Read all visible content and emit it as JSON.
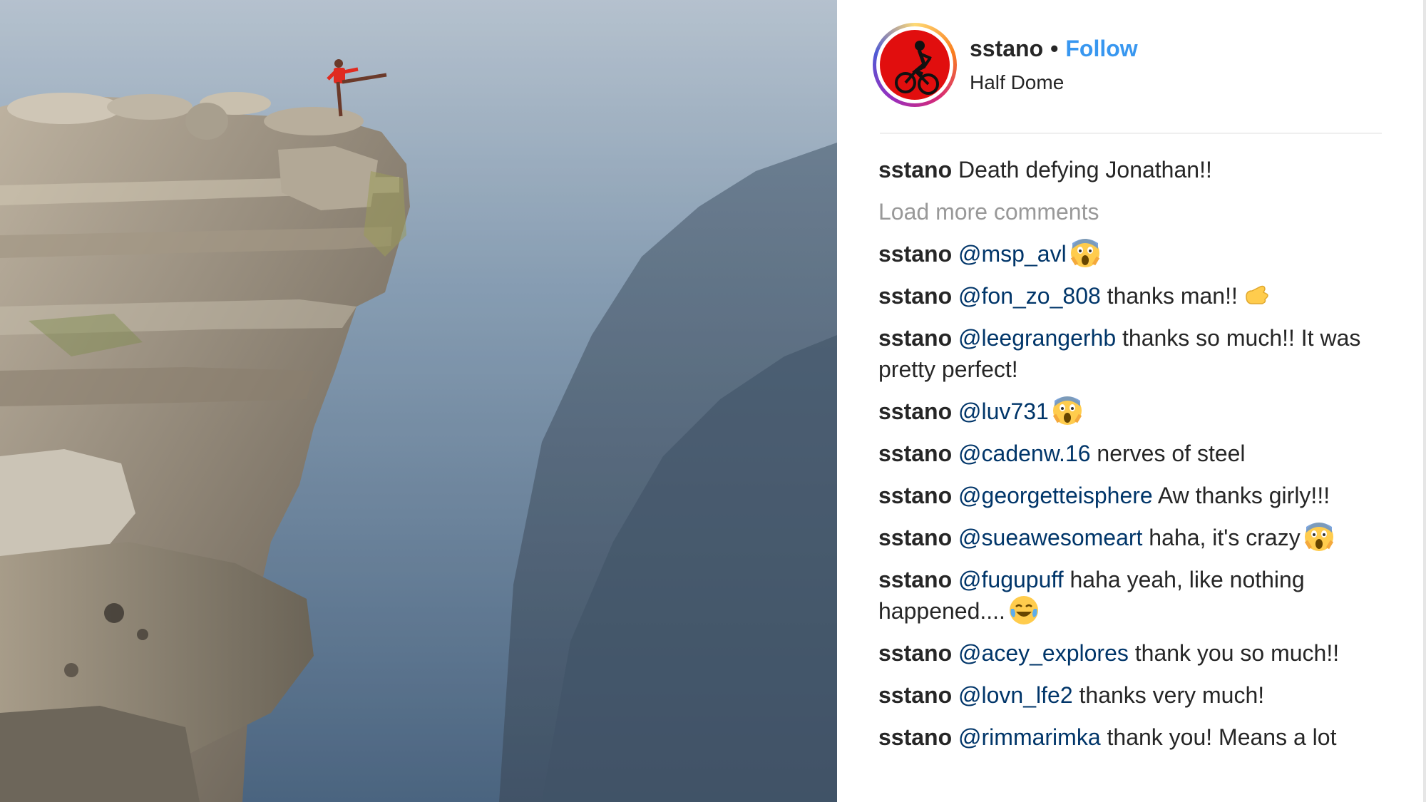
{
  "post": {
    "username": "sstano",
    "separator": "•",
    "follow_label": "Follow",
    "location": "Half Dome",
    "caption": {
      "user": "sstano",
      "text": "Death defying Jonathan!!"
    },
    "load_more_label": "Load more comments",
    "comments": [
      {
        "user": "sstano",
        "mention": "@msp_avl",
        "text": "",
        "emoji": "scream-emoji"
      },
      {
        "user": "sstano",
        "mention": "@fon_zo_808",
        "text": "thanks man!!",
        "emoji": "call-me-hand-emoji"
      },
      {
        "user": "sstano",
        "mention": "@leegrangerhb",
        "text": "thanks so much!! It was pretty perfect!",
        "emoji": ""
      },
      {
        "user": "sstano",
        "mention": "@luv731",
        "text": "",
        "emoji": "scream-emoji"
      },
      {
        "user": "sstano",
        "mention": "@cadenw.16",
        "text": "nerves of steel",
        "emoji": ""
      },
      {
        "user": "sstano",
        "mention": "@georgetteisphere",
        "text": "Aw thanks girly!!!",
        "emoji": ""
      },
      {
        "user": "sstano",
        "mention": "@sueawesomeart",
        "text": "haha, it's crazy",
        "emoji": "scream-emoji"
      },
      {
        "user": "sstano",
        "mention": "@fugupuff",
        "text": "haha yeah, like nothing happened....",
        "emoji": "tears-of-joy-emoji"
      },
      {
        "user": "sstano",
        "mention": "@acey_explores",
        "text": "thank you so much!!",
        "emoji": ""
      },
      {
        "user": "sstano",
        "mention": "@lovn_lfe2",
        "text": "thanks very much!",
        "emoji": ""
      },
      {
        "user": "sstano",
        "mention": "@rimmarimka",
        "text": "thank you! Means a lot",
        "emoji": ""
      }
    ]
  },
  "colors": {
    "follow": "#3897f0",
    "mention": "#003569",
    "muted": "#999999",
    "avatar_bg": "#e10e0e"
  },
  "photo": {
    "subject": "person-on-cliff-edge",
    "icon": "photo-image"
  }
}
